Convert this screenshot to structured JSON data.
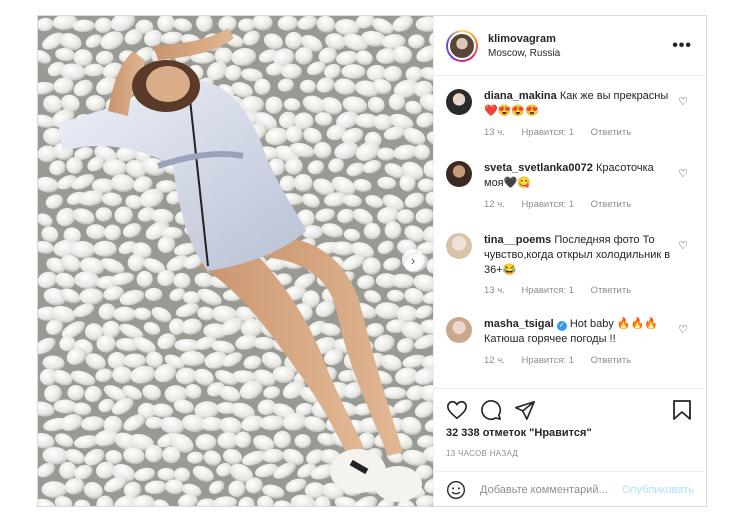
{
  "post": {
    "username": "klimovagram",
    "location": "Moscow, Russia",
    "more_icon": "more-horizontal-icon",
    "likes": "32 338 отметок \"Нравится\"",
    "time_ago": "13 ЧАСОВ НАЗАД",
    "comment_placeholder": "Добавьте комментарий...",
    "publish_label": "Опубликовать"
  },
  "comments": [
    {
      "user": "diana_makina",
      "text": "Как же вы прекрасны❤️😍😍😍",
      "time": "13 ч.",
      "likes": "Нравится: 1",
      "reply": "Ответить",
      "verified": false
    },
    {
      "user": "sveta_svetlanka0072",
      "text": "Красоточка моя🖤😋",
      "time": "12 ч.",
      "likes": "Нравится: 1",
      "reply": "Ответить",
      "verified": false
    },
    {
      "user": "tina__poems",
      "text": "Последняя фото То чувство,когда открыл холодильник в 36+😂",
      "time": "13 ч.",
      "likes": "Нравится: 1",
      "reply": "Ответить",
      "verified": false
    },
    {
      "user": "masha_tsigal",
      "text": "Hot baby 🔥🔥🔥 Катюша горячее погоды !!",
      "time": "12 ч.",
      "likes": "Нравится: 1",
      "reply": "Ответить",
      "verified": true
    }
  ],
  "colors": {
    "link_blue_disabled": "#b2dffc",
    "verified_blue": "#3897f0",
    "meta_gray": "#8e8e8e"
  }
}
